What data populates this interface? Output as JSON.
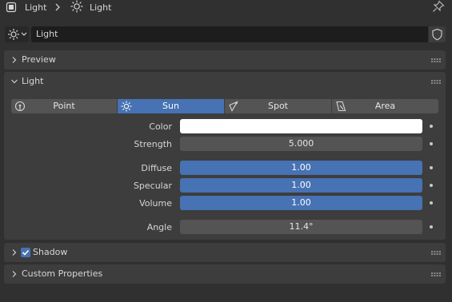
{
  "header": {
    "breadcrumb": [
      "Light",
      "Light"
    ],
    "pin_icon": "pin-icon"
  },
  "datablock": {
    "name": "Light",
    "type_icon": "sun-icon",
    "fake_user_icon": "shield-icon"
  },
  "panels": {
    "preview": {
      "title": "Preview",
      "expanded": false
    },
    "light": {
      "title": "Light",
      "expanded": true
    },
    "shadow": {
      "title": "Shadow",
      "expanded": false,
      "checked": true
    },
    "custom": {
      "title": "Custom Properties",
      "expanded": false
    }
  },
  "light_types": [
    {
      "label": "Point",
      "icon": "point-light-icon",
      "active": false
    },
    {
      "label": "Sun",
      "icon": "sun-icon",
      "active": true
    },
    {
      "label": "Spot",
      "icon": "spot-light-icon",
      "active": false
    },
    {
      "label": "Area",
      "icon": "area-light-icon",
      "active": false
    }
  ],
  "properties": {
    "color": {
      "label": "Color",
      "value": "#ffffff"
    },
    "strength": {
      "label": "Strength",
      "value": "5.000"
    },
    "diffuse": {
      "label": "Diffuse",
      "value": "1.00"
    },
    "specular": {
      "label": "Specular",
      "value": "1.00"
    },
    "volume": {
      "label": "Volume",
      "value": "1.00"
    },
    "angle": {
      "label": "Angle",
      "value": "11.4°"
    }
  },
  "colors": {
    "accent": "#4772b3",
    "panel": "#3d3d3d",
    "background": "#303030",
    "field": "#545454"
  }
}
